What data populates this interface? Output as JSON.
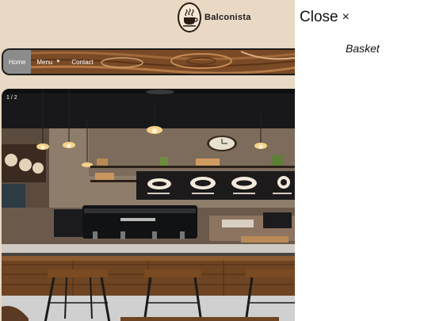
{
  "brand": {
    "name": "Balconista",
    "logo_icon": "coffee-cup-icon"
  },
  "nav": {
    "items": [
      {
        "label": "Home",
        "active": true
      },
      {
        "label": "Menu",
        "has_dropdown": true
      },
      {
        "label": "Contact"
      }
    ]
  },
  "slideshow": {
    "counter": "1 / 2"
  },
  "side_panel": {
    "close_label": "Close",
    "close_icon": "close-icon",
    "title": "Basket"
  },
  "colors": {
    "page_bg": "#e8d8c4",
    "nav_active": "#8c8c8c",
    "wood": "#7a4a26",
    "panel_bg": "#ffffff"
  }
}
